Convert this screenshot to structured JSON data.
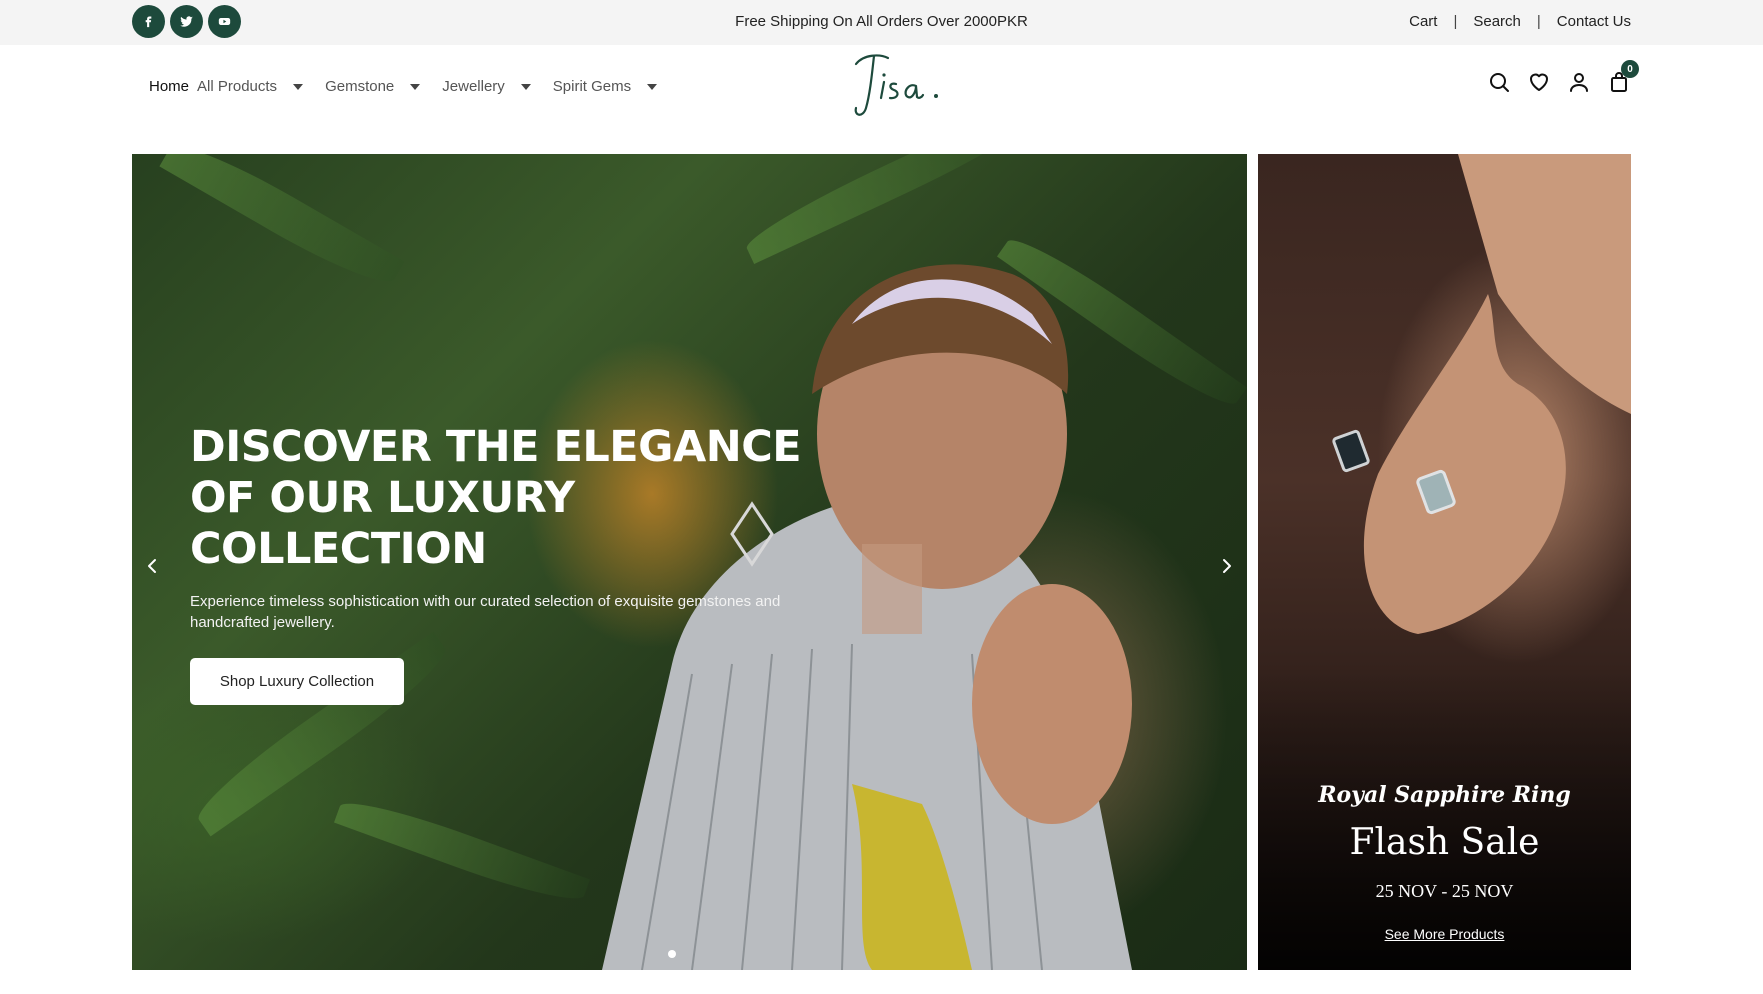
{
  "topbar": {
    "socials": [
      "facebook-icon",
      "twitter-icon",
      "youtube-icon"
    ],
    "announcement": "Free Shipping On All Orders Over 2000PKR",
    "links": [
      "Cart",
      "Search",
      "Contact Us"
    ],
    "separator": "|"
  },
  "header": {
    "nav": [
      {
        "label": "Home",
        "dropdown": false,
        "active": true
      },
      {
        "label": "All Products",
        "dropdown": true
      },
      {
        "label": "Gemstone",
        "dropdown": true
      },
      {
        "label": "Jewellery",
        "dropdown": true
      },
      {
        "label": "Spirit Gems",
        "dropdown": true
      }
    ],
    "logo_text": "Jisa.",
    "icons": [
      "search-icon",
      "heart-icon",
      "user-icon",
      "bag-icon"
    ],
    "cart_count": "0"
  },
  "hero": {
    "title": "Discover the Elegance of Our Luxury Collection",
    "subtitle": "Experience timeless sophistication with our curated selection of exquisite gemstones and handcrafted jewellery.",
    "button": "Shop Luxury Collection",
    "slides_total": 1,
    "active_slide": 1
  },
  "promo": {
    "script_title": "Royal Sapphire Ring",
    "title": "Flash Sale",
    "dates": "25 NOV - 25 NOV",
    "link": "See More Products"
  },
  "colors": {
    "brand_green": "#1d4a3c",
    "topbar_bg": "#f4f4f4"
  }
}
